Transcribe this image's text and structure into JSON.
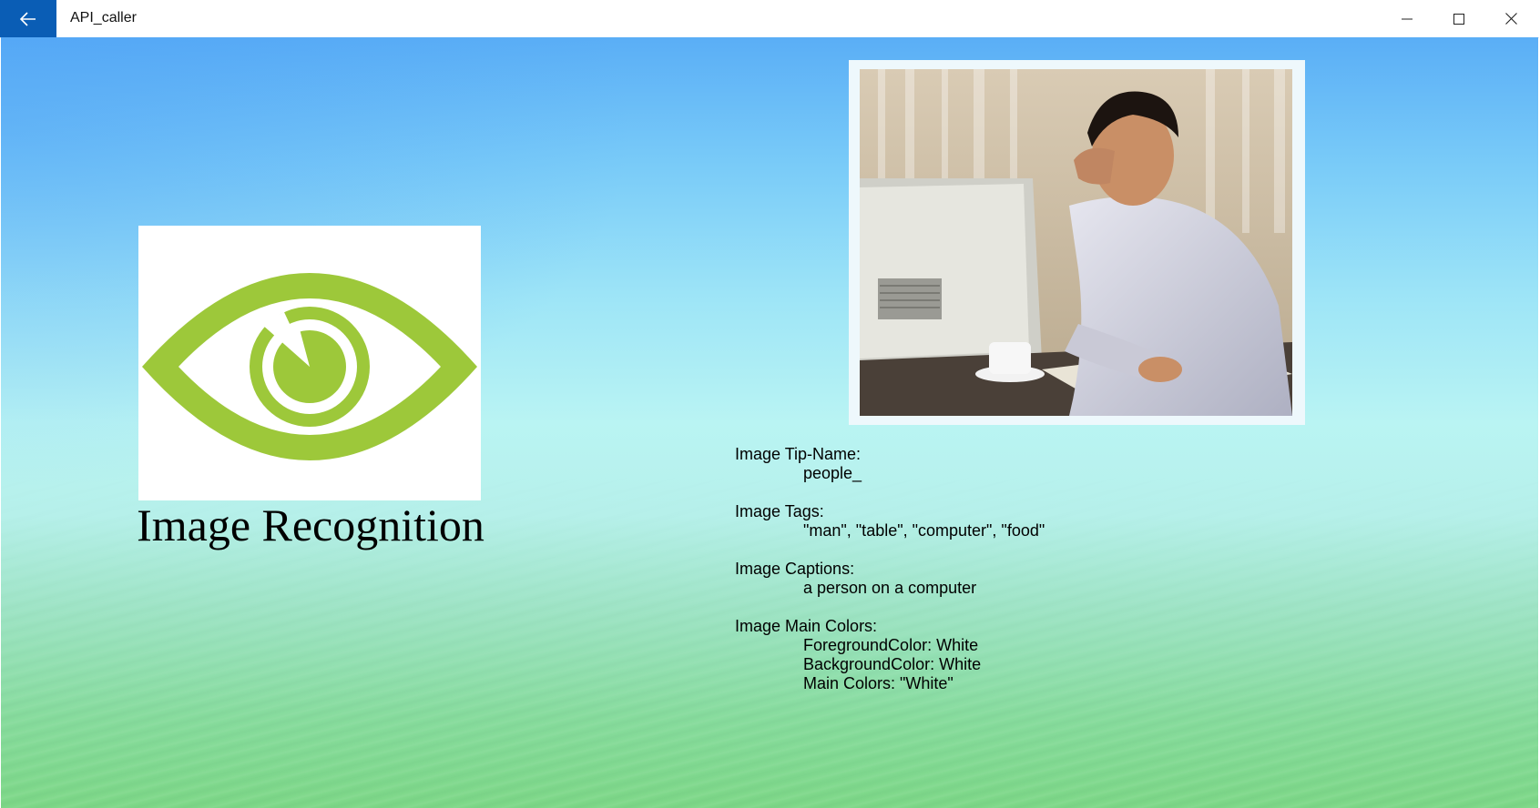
{
  "window": {
    "title": "API_caller",
    "accent_color": "#0a5db5"
  },
  "icons": {
    "back": "back-arrow-icon",
    "minimize": "minimize-icon",
    "maximize": "maximize-icon",
    "close": "close-icon",
    "logo": "eye-icon"
  },
  "left": {
    "heading": "Image Recognition",
    "logo_color": "#9dc83a"
  },
  "results": {
    "tip_name_label": "Image Tip-Name:",
    "tip_name_value": "people_",
    "tags_label": "Image Tags:",
    "tags_value": "\"man\",  \"table\",  \"computer\",  \"food\"",
    "captions_label": "Image Captions:",
    "captions_value": "a person on a computer",
    "colors_label": "Image Main Colors:",
    "foreground": "ForegroundColor: White",
    "background": "BackgroundColor: White",
    "main_colors": "Main Colors: \"White\""
  }
}
